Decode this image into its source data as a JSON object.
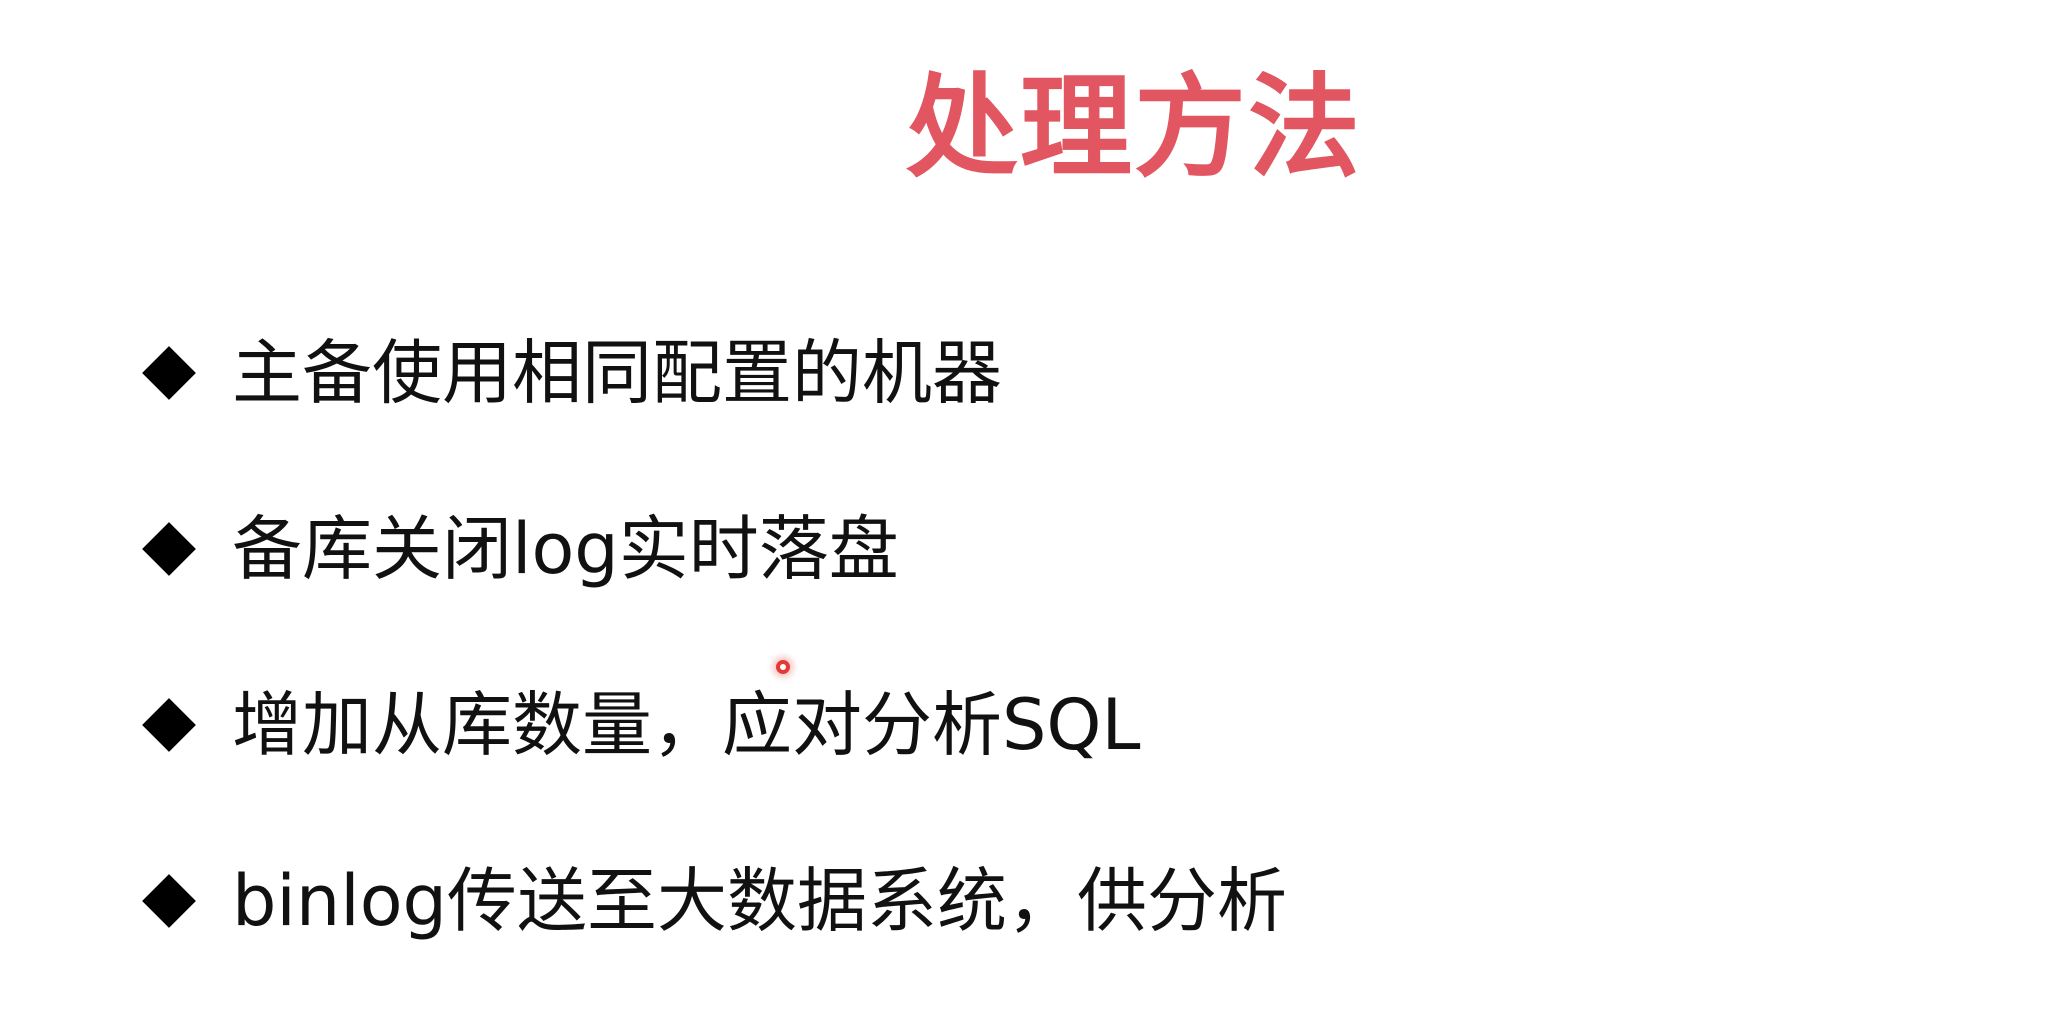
{
  "slide": {
    "title": "处理方法",
    "title_color": "#e15660",
    "bullets": [
      {
        "text": "主备使用相同配置的机器"
      },
      {
        "text": "备库关闭log实时落盘"
      },
      {
        "text": "增加从库数量，应对分析SQL"
      },
      {
        "text": "binlog传送至大数据系统，供分析"
      }
    ],
    "bullet_icon": "diamond-icon",
    "pointer_icon": "laser-pointer-icon"
  }
}
